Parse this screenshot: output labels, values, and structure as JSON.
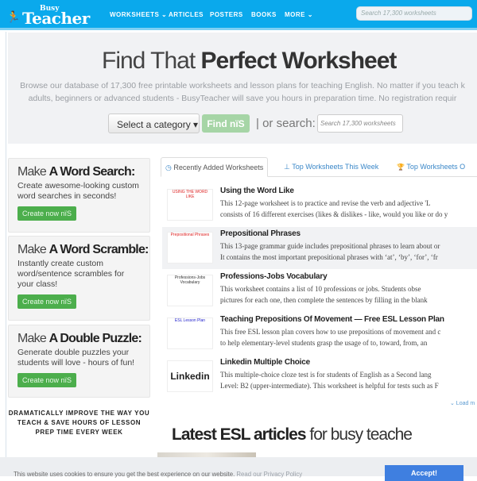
{
  "header": {
    "logo_small": "Busy",
    "logo_main": "Teacher",
    "nav": [
      "WORKSHEETS ⌄",
      "ARTICLES",
      "POSTERS",
      "BOOKS",
      "MORE ⌄"
    ],
    "search_placeholder": "Search 17,300 worksheets"
  },
  "hero": {
    "title_light": "Find That ",
    "title_bold": "Perfect Worksheet",
    "line1": "Browse our database of 17,300 free printable worksheets and lesson plans for teaching English. No matter if you teach k",
    "line2": "adults, beginners or advanced students - BusyTeacher will save you hours in preparation time. No registration requir",
    "category_label": "Select a category ▾",
    "find_label": "Find nïS",
    "or_search": "| or search:",
    "search_placeholder": "Search 17,300 worksheets"
  },
  "sidebar": {
    "boxes": [
      {
        "make": "Make ",
        "title": "A Word Search:",
        "desc": "Create awesome-looking custom word searches in seconds!",
        "button": "Create now nïS"
      },
      {
        "make": "Make ",
        "title": "A Word Scramble:",
        "desc": "Instantly create custom word/sentence scrambles for your class!",
        "button": "Create now nïS"
      },
      {
        "make": "Make ",
        "title": "A Double Puzzle:",
        "desc": "Generate double puzzles your students will love - hours of fun!",
        "button": "Create now nïS"
      }
    ],
    "tagline": "DRAMATICALLY IMPROVE THE WAY YOU TEACH & SAVE HOURS OF LESSON PREP TIME EVERY WEEK"
  },
  "tabs": [
    {
      "icon": "◷",
      "label": "Recently Added Worksheets"
    },
    {
      "icon": "⊥",
      "label": "Top Worksheets This Week"
    },
    {
      "icon": "🏆",
      "label": "Top Worksheets O"
    }
  ],
  "items": [
    {
      "title": "Using the Word Like",
      "thumb": "USING THE WORD LIKE",
      "l1": "This 12-page worksheet is to practice and revise the verb and adjective 'L",
      "l2": "consists of 16 different exercises (likes & dislikes - like, would you like or do y"
    },
    {
      "title": "Prepositional Phrases",
      "thumb": "Prepositional Phrases",
      "l1": " This 13-page grammar guide includes prepositional phrases to learn about or",
      "l2": "It contains the most important prepositional phrases with ‘at’, ‘by’, ‘for’, ‘fr"
    },
    {
      "title": "Professions-Jobs Vocabulary",
      "thumb": "Professions-Jobs Vocabulary",
      "l1": "  This worksheet contains a list of 10 professions or jobs. Students obse",
      "l2": "pictures for each one, then complete the sentences by filling in the blank"
    },
    {
      "title": "Teaching Prepositions Of Movement — Free ESL Lesson Plan",
      "thumb": "ESL Lesson Plan",
      "l1": " This free ESL lesson plan covers how to use prepositions of movement and c",
      "l2": "to help elementary-level students grasp the usage of to, toward, from, an"
    },
    {
      "title": "Linkedin Multiple Choice",
      "thumb": "Linkedin",
      "l1": "   This multiple-choice cloze test is for students of English as a Second lang",
      "l2": "Level: B2 (upper-intermediate). This worksheet is helpful for tests such as F"
    }
  ],
  "load_more": "⌄ Load m",
  "latest": {
    "bold": "Latest ESL articles",
    "light": " for busy teache"
  },
  "cookie": {
    "text": "This website uses cookies to ensure you get the best experience on our website. ",
    "link": "Read our Privacy Policy",
    "accept": "Accept!"
  }
}
